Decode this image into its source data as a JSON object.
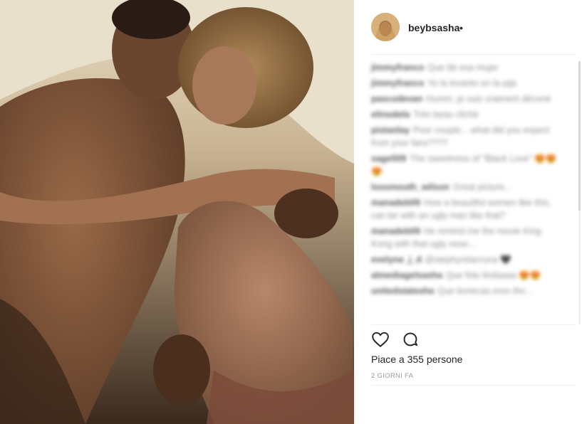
{
  "post": {
    "username": "beybsasha",
    "follow_dot": "•",
    "likes_text": "Piace a 355 persone",
    "timestamp": "2 GIORNI FA"
  },
  "comments": [
    {
      "user": "jimmyfranco",
      "text": "Que bb esa mujer"
    },
    {
      "user": "jimmyfranco",
      "text": "Yo la levanto en la pija"
    },
    {
      "user": "pascodevan",
      "text": "Humm ,je suis vraiment déconé"
    },
    {
      "user": "elinodela",
      "text": "Très beau cliché"
    },
    {
      "user": "pistanlay",
      "text": "Poor couple... what did you expect from your fans????"
    },
    {
      "user": "sage509",
      "text": "The sweetness of \"Black Love\" 😍😍😍"
    },
    {
      "user": "loosmouth_wilson",
      "text": "Great picture..."
    },
    {
      "user": "manadeb09",
      "text": "How a beautiful women like this, can be with an ugly man like that?"
    },
    {
      "user": "manadeb09",
      "text": "He remind me the movie King Kong with that ugly nose..."
    },
    {
      "user": "evelyne_j_d",
      "text": "@stephyrelacruna 🖤"
    },
    {
      "user": "almediagelsasha",
      "text": "Que foto lindaaaa 😍😍"
    },
    {
      "user": "unitedstatesha",
      "text": "Que bonecas eres tho..."
    }
  ],
  "icons": {
    "like": "heart-icon",
    "comment": "comment-icon"
  },
  "colors": {
    "text": "#262626",
    "muted": "#999999",
    "divider": "#efefef"
  }
}
